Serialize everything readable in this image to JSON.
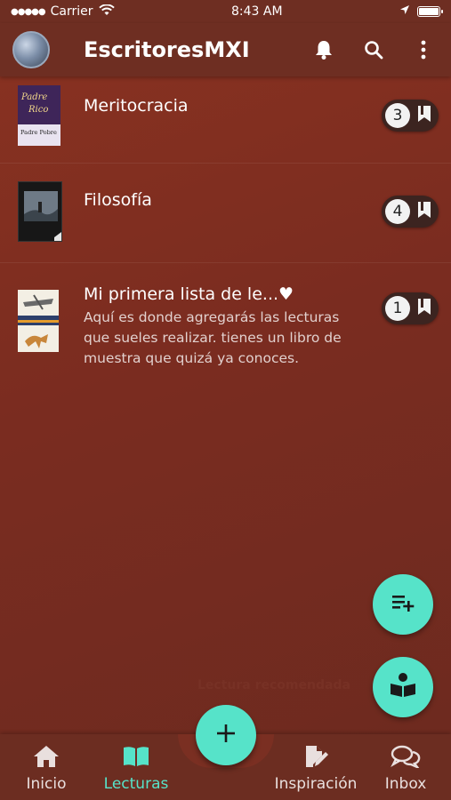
{
  "status_bar": {
    "carrier": "Carrier",
    "time": "8:43 AM"
  },
  "app_bar": {
    "title": "EscritoresMXI"
  },
  "lists": [
    {
      "title": "Meritocracia",
      "description": "",
      "count": "3",
      "cover_text": [
        "Padre",
        "Rico",
        "Padre Pobre"
      ]
    },
    {
      "title": "Filosofía",
      "description": "",
      "count": "4"
    },
    {
      "title": "Mi primera lista de le...♥",
      "description": "Aquí es donde agregarás las lecturas que sueles realizar. tienes un libro de muestra que quizá ya conoces.",
      "count": "1"
    }
  ],
  "recommended_label": "Lectura recomendada",
  "bottom_nav": {
    "items": [
      {
        "label": "Inicio",
        "icon": "home-icon"
      },
      {
        "label": "Lecturas",
        "icon": "book-open-icon"
      },
      {
        "label": "Inspiración",
        "icon": "document-edit-icon"
      },
      {
        "label": "Inbox",
        "icon": "chat-bubbles-icon"
      }
    ]
  },
  "colors": {
    "accent": "#56e3c9",
    "background": "#7a2f22",
    "app_bar": "#6e2e22"
  }
}
